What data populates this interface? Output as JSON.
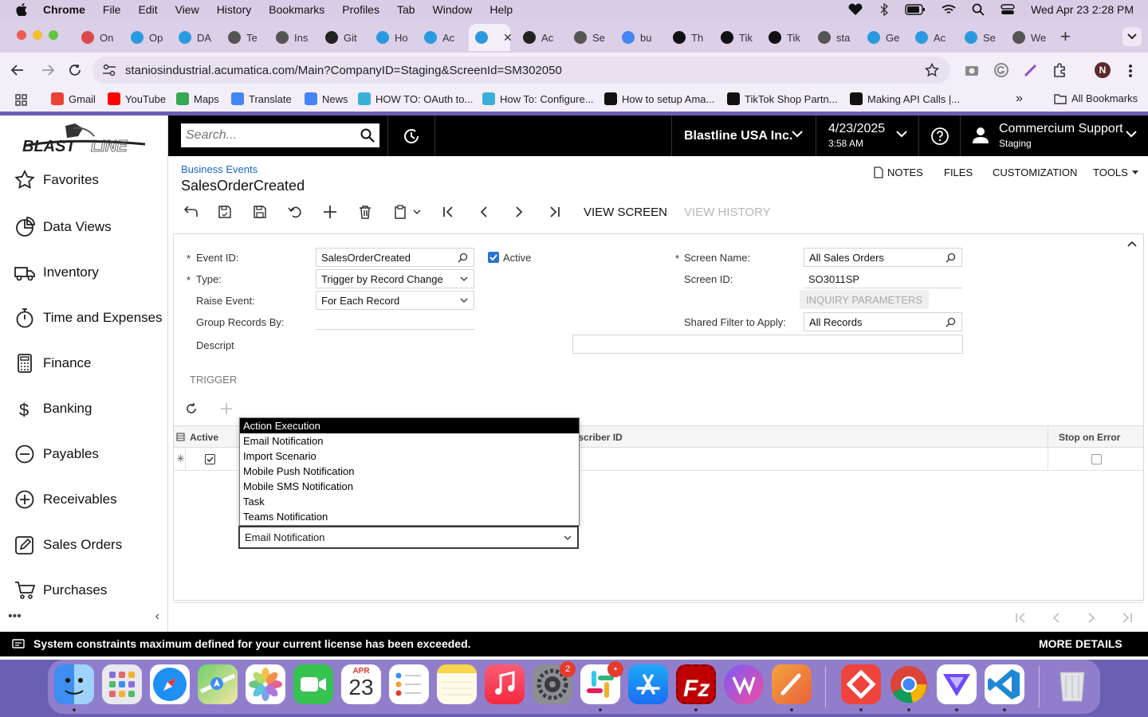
{
  "menubar": {
    "app": "Chrome",
    "items": [
      "File",
      "Edit",
      "View",
      "History",
      "Bookmarks",
      "Profiles",
      "Tab",
      "Window",
      "Help"
    ],
    "clock": "Wed Apr 23  2:28 PM"
  },
  "tabs": [
    {
      "label": "On",
      "color": "#d84a4a"
    },
    {
      "label": "Op",
      "color": "#2a9ae0"
    },
    {
      "label": "DA",
      "color": "#2a9ae0"
    },
    {
      "label": "Te",
      "color": "#555555"
    },
    {
      "label": "Ins",
      "color": "#555555"
    },
    {
      "label": "Git",
      "color": "#222222"
    },
    {
      "label": "Ho",
      "color": "#2a9ae0"
    },
    {
      "label": "Ac",
      "color": "#2a9ae0"
    },
    {
      "label": "",
      "color": "#2a9ae0",
      "active": true
    },
    {
      "label": "Ac",
      "color": "#222222"
    },
    {
      "label": "Se",
      "color": "#555555"
    },
    {
      "label": "bu",
      "color": "#4285f4"
    },
    {
      "label": "Th",
      "color": "#111111"
    },
    {
      "label": "Tik",
      "color": "#111111"
    },
    {
      "label": "Tik",
      "color": "#111111"
    },
    {
      "label": "sta",
      "color": "#555555"
    },
    {
      "label": "Ge",
      "color": "#2a9ae0"
    },
    {
      "label": "Ac",
      "color": "#2a9ae0"
    },
    {
      "label": "Se",
      "color": "#2a9ae0"
    },
    {
      "label": "We",
      "color": "#555555"
    }
  ],
  "address": {
    "url": "staniosindustrial.acumatica.com/Main?CompanyID=Staging&ScreenId=SM302050",
    "profile_initial": "N"
  },
  "bookmarks": {
    "items": [
      {
        "label": "Gmail",
        "color": "#ea4335"
      },
      {
        "label": "YouTube",
        "color": "#ff0000"
      },
      {
        "label": "Maps",
        "color": "#34a853"
      },
      {
        "label": "Translate",
        "color": "#4285f4"
      },
      {
        "label": "News",
        "color": "#4285f4"
      },
      {
        "label": "HOW TO: OAuth to...",
        "color": "#3ab0d8"
      },
      {
        "label": "How To: Configure...",
        "color": "#3ab0d8"
      },
      {
        "label": "How to setup Ama...",
        "color": "#111111"
      },
      {
        "label": "TikTok Shop Partn...",
        "color": "#111111"
      },
      {
        "label": "Making API Calls |...",
        "color": "#111111"
      }
    ],
    "all": "All Bookmarks"
  },
  "sidebar": {
    "items": [
      {
        "label": "Favorites",
        "icon": "star-icon"
      },
      {
        "label": "Data Views",
        "icon": "pie-chart-icon"
      },
      {
        "label": "Inventory",
        "icon": "truck-icon"
      },
      {
        "label": "Time and Expenses",
        "icon": "stopwatch-icon"
      },
      {
        "label": "Finance",
        "icon": "calculator-icon"
      },
      {
        "label": "Banking",
        "icon": "dollar-icon"
      },
      {
        "label": "Payables",
        "icon": "minus-circle-icon"
      },
      {
        "label": "Receivables",
        "icon": "plus-circle-icon"
      },
      {
        "label": "Sales Orders",
        "icon": "pencil-square-icon"
      },
      {
        "label": "Purchases",
        "icon": "cart-icon"
      }
    ]
  },
  "topbar": {
    "search_placeholder": "Search...",
    "company": "Blastline USA Inc.",
    "date": "4/23/2025",
    "time": "3:58 AM",
    "user": "Commercium Support",
    "tenant": "Staging"
  },
  "page": {
    "breadcrumb": "Business Events",
    "title": "SalesOrderCreated",
    "links": {
      "notes": "NOTES",
      "files": "FILES",
      "customization": "CUSTOMIZATION",
      "tools": "TOOLS"
    },
    "toolbar": {
      "view_screen": "VIEW SCREEN",
      "view_history": "VIEW HISTORY"
    }
  },
  "form": {
    "event_id_label": "Event ID:",
    "event_id": "SalesOrderCreated",
    "active_label": "Active",
    "type_label": "Type:",
    "type": "Trigger by Record Change",
    "raise_label": "Raise Event:",
    "raise": "For Each Record",
    "group_label": "Group Records By:",
    "desc_label": "Descript",
    "screen_name_label": "Screen Name:",
    "screen_name": "All Sales Orders",
    "screen_id_label": "Screen ID:",
    "screen_id": "SO3011SP",
    "inquiry_btn": "INQUIRY PARAMETERS",
    "filter_label": "Shared Filter to Apply:",
    "filter": "All Records",
    "triggers_tab": "TRIGGER"
  },
  "grid": {
    "col_active": "Active",
    "col_subscriber": "bscriber ID",
    "col_stop": "Stop on Error",
    "row_type": "Email Notification"
  },
  "dropdown": {
    "options": [
      "Action Execution",
      "Email Notification",
      "Import Scenario",
      "Mobile Push Notification",
      "Mobile SMS Notification",
      "Task",
      "Teams Notification"
    ],
    "highlighted": "Action Execution"
  },
  "status": {
    "message": "System constraints maximum defined for your current license has been exceeded.",
    "action": "MORE DETAILS"
  },
  "dock": {
    "calendar_month": "APR",
    "calendar_day": "23",
    "settings_badge": "2",
    "slack_badge": "•"
  }
}
